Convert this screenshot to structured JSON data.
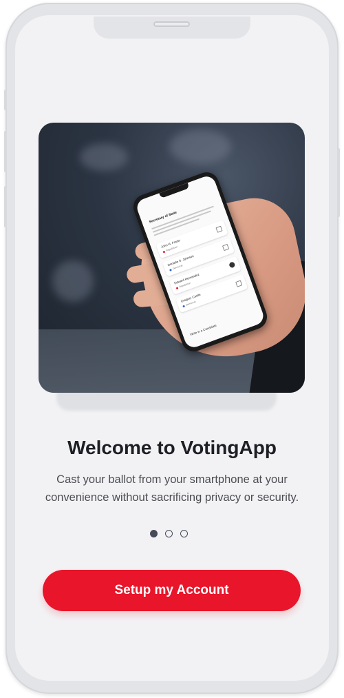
{
  "onboarding": {
    "title": "Welcome to VotingApp",
    "subtitle": "Cast your ballot from your smartphone at your convenience without sacrificing privacy or security.",
    "pagination": {
      "total": 3,
      "active": 1
    },
    "cta_label": "Setup my Account"
  },
  "hero_mockup": {
    "section_title": "Secretary of State",
    "candidates": [
      {
        "name": "John H. Foster",
        "party": "Republican",
        "selected": false
      },
      {
        "name": "Danielle S. Johnson",
        "party": "Democrat",
        "selected": false
      },
      {
        "name": "Edward Hernandez",
        "party": "Republican",
        "selected": true
      },
      {
        "name": "Gregory Castle",
        "party": "Democrat",
        "selected": false
      }
    ],
    "write_in": "Write in a Candidate"
  },
  "colors": {
    "accent": "#e9152a",
    "text_primary": "#1e1f24",
    "text_secondary": "#4c4d52",
    "background": "#f2f2f4",
    "dot": "#454b58"
  }
}
